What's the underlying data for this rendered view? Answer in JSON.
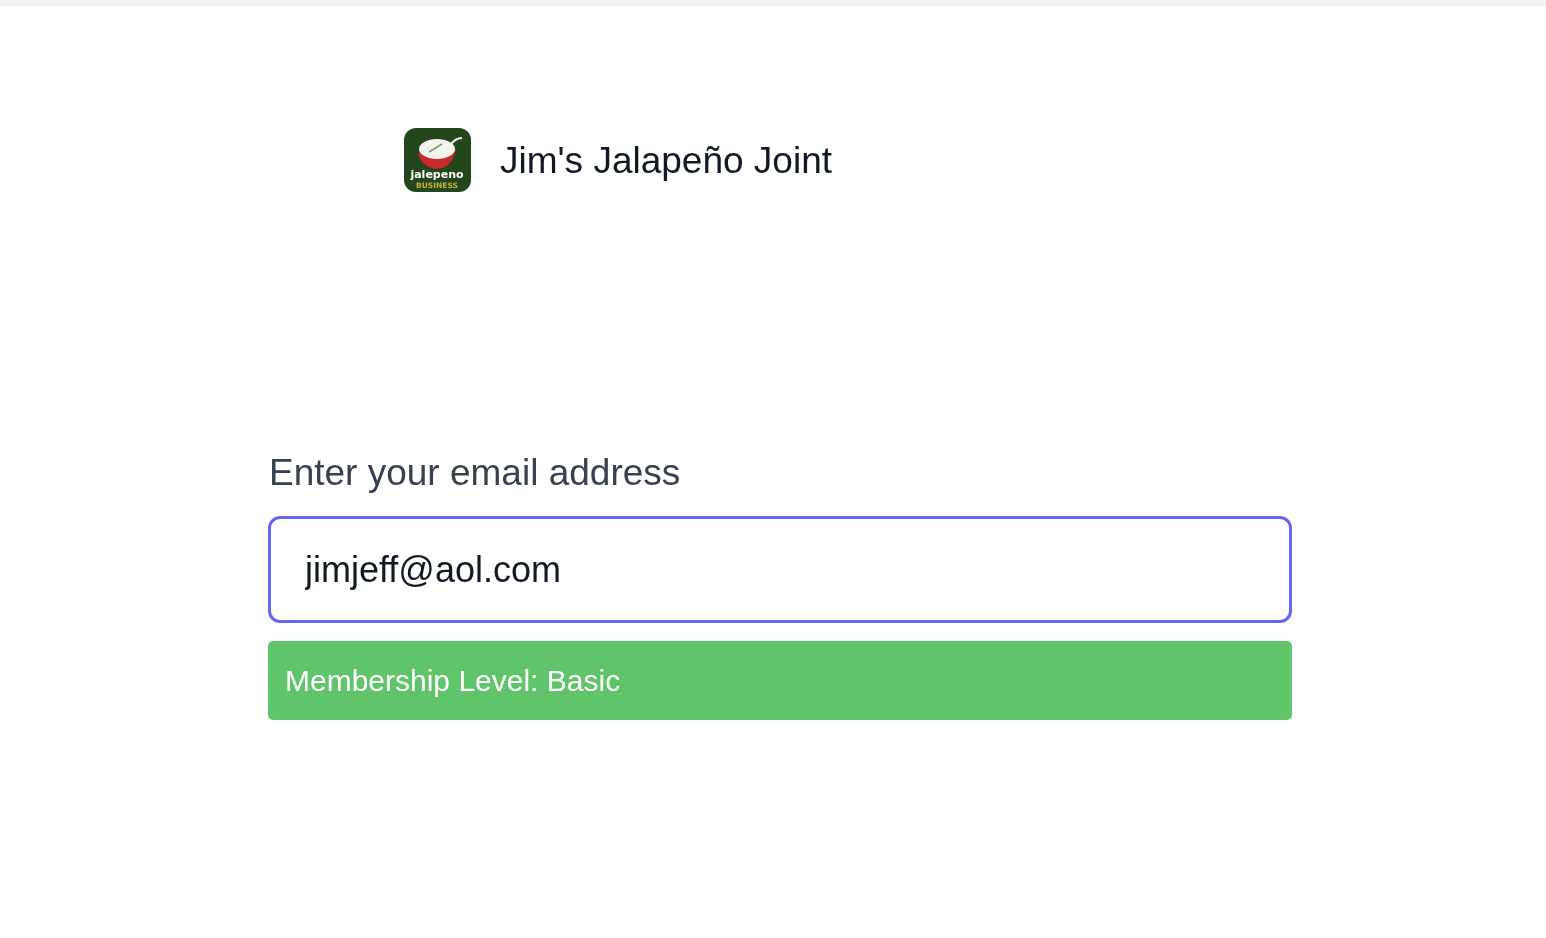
{
  "header": {
    "logo": {
      "text": "jalepeno",
      "subtext": "BUSINESS"
    },
    "title": "Jim's Jalapeño Joint"
  },
  "email_form": {
    "label": "Enter your email address",
    "value": "jimjeff@aol.com",
    "focused": true
  },
  "membership_banner": {
    "text": "Membership Level: Basic"
  }
}
